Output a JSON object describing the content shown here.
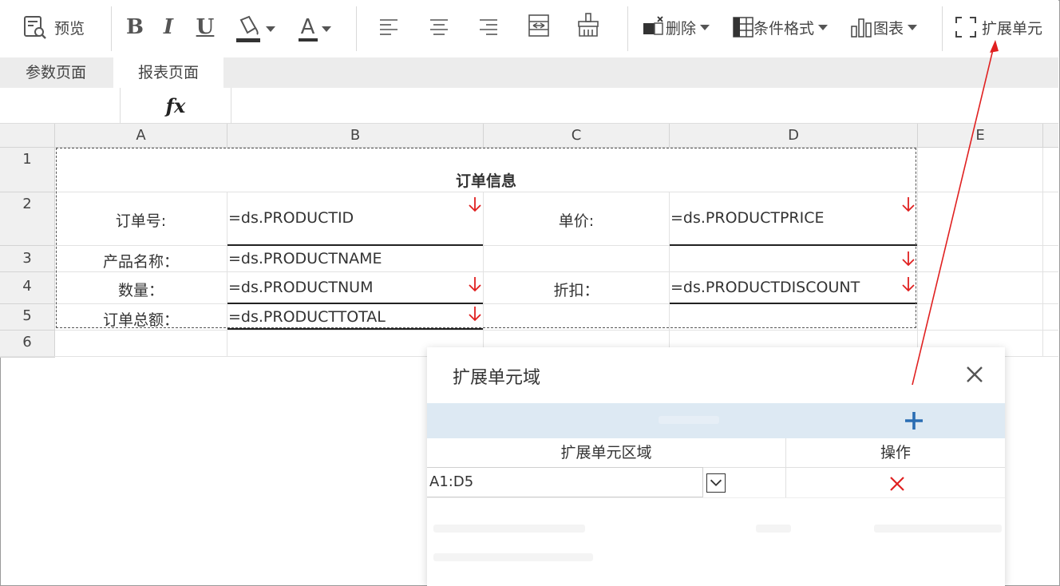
{
  "toolbar": {
    "preview": "预览",
    "bold": "B",
    "italic": "I",
    "underline": "U",
    "font_color": "A",
    "delete": "删除",
    "conditional_format": "条件格式",
    "chart": "图表",
    "expand_cell": "扩展单元"
  },
  "tabs": [
    "参数页面",
    "报表页面"
  ],
  "active_tab": 1,
  "formula_bar": {
    "fx": "fx"
  },
  "columns": [
    "A",
    "B",
    "C",
    "D",
    "E"
  ],
  "rows": [
    "1",
    "2",
    "3",
    "4",
    "5",
    "6"
  ],
  "cells": {
    "title": "订单信息",
    "order_no_label": "订单号:",
    "order_no_value": "=ds.PRODUCTID",
    "price_label": "单价:",
    "price_value": "=ds.PRODUCTPRICE",
    "name_label": "产品名称：",
    "name_value": "=ds.PRODUCTNAME",
    "qty_label": "数量：",
    "qty_value": "=ds.PRODUCTNUM",
    "discount_label": "折扣：",
    "discount_value": "=ds.PRODUCTDISCOUNT",
    "total_label": "订单总额：",
    "total_value": "=ds.PRODUCTTOTAL"
  },
  "dialog": {
    "title": "扩展单元域",
    "col_region": "扩展单元区域",
    "col_action": "操作",
    "region_value": "A1:D5"
  },
  "colors": {
    "arrow": "#e02020",
    "dialog_bar": "#dde9f3",
    "add_icon": "#2a6db3"
  }
}
